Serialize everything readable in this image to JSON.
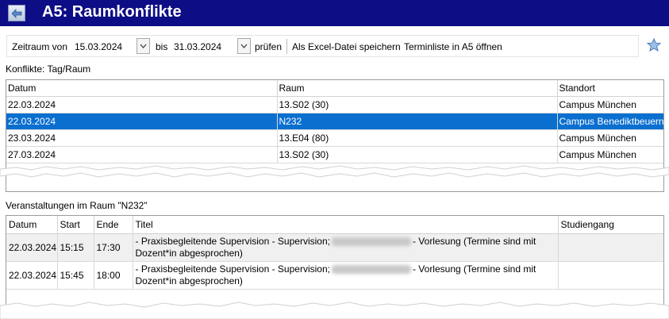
{
  "window": {
    "title": "A5: Raumkonflikte"
  },
  "toolbar": {
    "from_label": "Zeitraum von",
    "from_value": "15.03.2024",
    "to_label": "bis",
    "to_value": "31.03.2024",
    "check_button": "prüfen",
    "excel_button": "Als Excel-Datei speichern",
    "open_button": "Terminliste in A5 öffnen"
  },
  "conflicts": {
    "label": "Konflikte: Tag/Raum",
    "columns": [
      "Datum",
      "Raum",
      "Standort"
    ],
    "rows": [
      [
        "22.03.2024",
        "13.S02 (30)",
        "Campus München"
      ],
      [
        "22.03.2024",
        "N232",
        "Campus Benediktbeuern"
      ],
      [
        "23.03.2024",
        "13.E04 (80)",
        "Campus München"
      ],
      [
        "27.03.2024",
        "13.S02 (30)",
        "Campus München"
      ]
    ]
  },
  "events": {
    "label": "Veranstaltungen im Raum \"N232\"",
    "columns": [
      "Datum",
      "Start",
      "Ende",
      "Titel",
      "Studiengang"
    ],
    "rows": [
      {
        "date": "22.03.2024",
        "start": "15:15",
        "end": "17:30",
        "title_pre": " - Praxisbegleitende Supervision - Supervision;",
        "title_post": "- Vorlesung (Termine sind mit Dozent*in abgesprochen)",
        "program": ""
      },
      {
        "date": "22.03.2024",
        "start": "15:45",
        "end": "18:00",
        "title_pre": " - Praxisbegleitende Supervision - Supervision;",
        "title_post": "- Vorlesung (Termine sind mit Dozent*in abgesprochen)",
        "program": ""
      }
    ]
  }
}
